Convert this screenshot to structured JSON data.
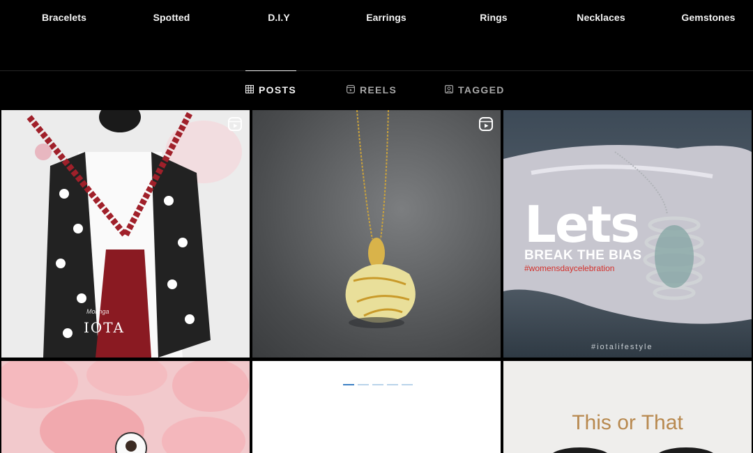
{
  "highlights": [
    {
      "label": "Bracelets"
    },
    {
      "label": "Spotted"
    },
    {
      "label": "D.I.Y"
    },
    {
      "label": "Earrings"
    },
    {
      "label": "Rings"
    },
    {
      "label": "Necklaces"
    },
    {
      "label": "Gemstones"
    }
  ],
  "tabs": [
    {
      "label": "POSTS",
      "icon": "grid-icon",
      "active": true
    },
    {
      "label": "REELS",
      "icon": "reels-icon",
      "active": false
    },
    {
      "label": "TAGGED",
      "icon": "tagged-icon",
      "active": false
    }
  ],
  "posts": [
    {
      "type": "reel",
      "overlay_text": "IOTA",
      "overlay_small": "Moringa"
    },
    {
      "type": "reel"
    },
    {
      "type": "image",
      "title": "Lets",
      "subtitle": "BREAK THE BIAS",
      "hashtag": "#womensdaycelebration",
      "footer": "#iotalifestyle"
    },
    {
      "type": "image"
    },
    {
      "type": "image",
      "state": "loading"
    },
    {
      "type": "image",
      "title": "This or That"
    }
  ],
  "colors": {
    "background": "#000000",
    "text_primary": "#f5f5f5",
    "text_secondary": "#a8a8a8",
    "divider": "#262626",
    "accent_hashtag": "#d4302b",
    "this_or_that": "#b8894f"
  }
}
